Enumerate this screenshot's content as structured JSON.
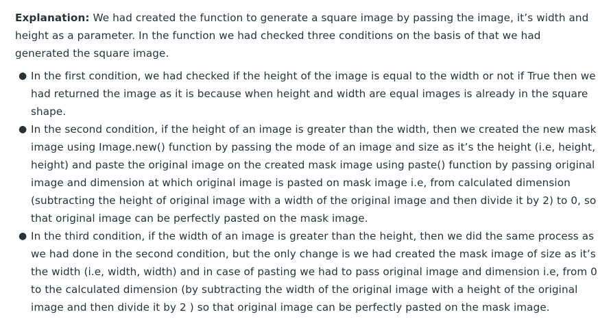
{
  "explanation": {
    "label": "Explanation:",
    "intro": " We had created the function to generate a square image by passing the image, it’s width and height as a parameter. In the function we had checked three conditions on the basis of that we had generated the square image."
  },
  "bullets": [
    {
      "text": "In the first condition, we had checked if the height of the image is equal to the width or not if True then we had returned the image as it is because when height and width are equal images is already in the square shape."
    },
    {
      "text": "In the second condition, if the height of an image is greater than the width, then we created the new mask image using Image.new() function by passing the mode of an image and size as it’s the height (i.e, height, height) and paste the original image on the created mask image using paste() function by passing original image and dimension at which original image is pasted on mask image i.e, from calculated dimension (subtracting the height of original image with a width of the original image and then divide it by 2) to 0, so that original image can be perfectly pasted on the mask image."
    },
    {
      "text": "In the third condition, if the width of an image is greater than the height, then we did the same process as we had done in the second condition, but the only change is we had created the mask image of size as it’s the width (i.e, width, width) and in case of pasting we had to pass original image and dimension i.e, from 0 to the calculated dimension (by subtracting the width of the original image with a height of the original image and then divide it by 2 ) so that original image can be perfectly pasted on the mask image."
    }
  ]
}
